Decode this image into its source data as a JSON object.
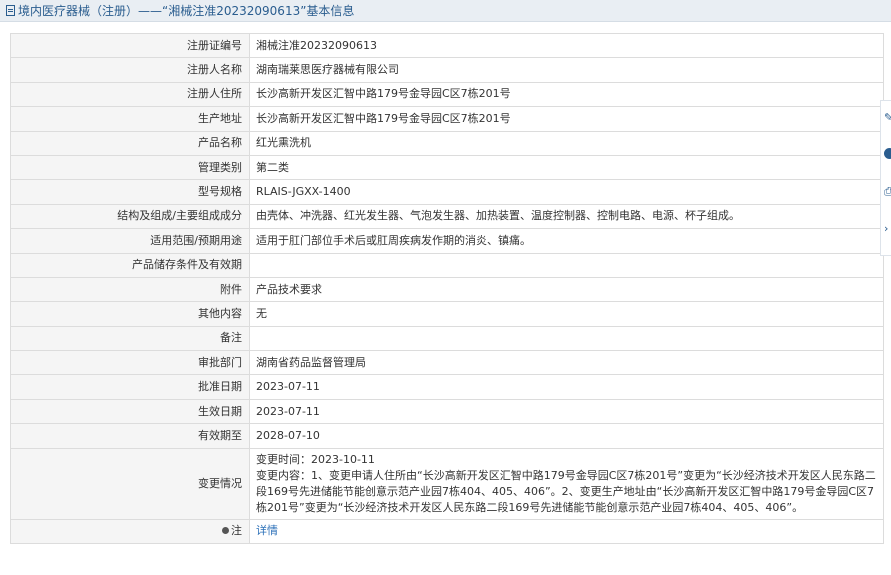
{
  "header": {
    "prefix": "境内医疗器械（注册）",
    "separator": " —— ",
    "title_suffix": "“湘械注准20232090613”基本信息"
  },
  "rows": [
    {
      "label": "注册证编号",
      "value": "湘械注准20232090613"
    },
    {
      "label": "注册人名称",
      "value": "湖南瑞莱思医疗器械有限公司"
    },
    {
      "label": "注册人住所",
      "value": "长沙高新开发区汇智中路179号金导园C区7栋201号"
    },
    {
      "label": "生产地址",
      "value": "长沙高新开发区汇智中路179号金导园C区7栋201号"
    },
    {
      "label": "产品名称",
      "value": "红光熏洗机"
    },
    {
      "label": "管理类别",
      "value": "第二类"
    },
    {
      "label": "型号规格",
      "value": "RLAIS-JGXX-1400"
    },
    {
      "label": "结构及组成/主要组成成分",
      "value": "由壳体、冲洗器、红光发生器、气泡发生器、加热装置、温度控制器、控制电路、电源、杯子组成。"
    },
    {
      "label": "适用范围/预期用途",
      "value": "适用于肛门部位手术后或肛周疾病发作期的消炎、镇痛。"
    },
    {
      "label": "产品储存条件及有效期",
      "value": ""
    },
    {
      "label": "附件",
      "value": "产品技术要求"
    },
    {
      "label": "其他内容",
      "value": "无"
    },
    {
      "label": "备注",
      "value": ""
    },
    {
      "label": "审批部门",
      "value": "湖南省药品监督管理局"
    },
    {
      "label": "批准日期",
      "value": "2023-07-11"
    },
    {
      "label": "生效日期",
      "value": "2023-07-11"
    },
    {
      "label": "有效期至",
      "value": "2028-07-10"
    }
  ],
  "change": {
    "label": "变更情况",
    "time": "变更时间：2023-10-11",
    "content": "变更内容：1、变更申请人住所由“长沙高新开发区汇智中路179号金导园C区7栋201号”变更为“长沙经济技术开发区人民东路二段169号先进储能节能创意示范产业园7栋404、405、406”。2、变更生产地址由“长沙高新开发区汇智中路179号金导园C区7栋201号”变更为“长沙经济技术开发区人民东路二段169号先进储能节能创意示范产业园7栋404、405、406”。"
  },
  "note": {
    "label": "注",
    "link_text": "详情"
  },
  "side_toolbar": {
    "icons": [
      "edit-icon",
      "help-icon",
      "print-icon",
      "chevron-right-icon"
    ]
  }
}
